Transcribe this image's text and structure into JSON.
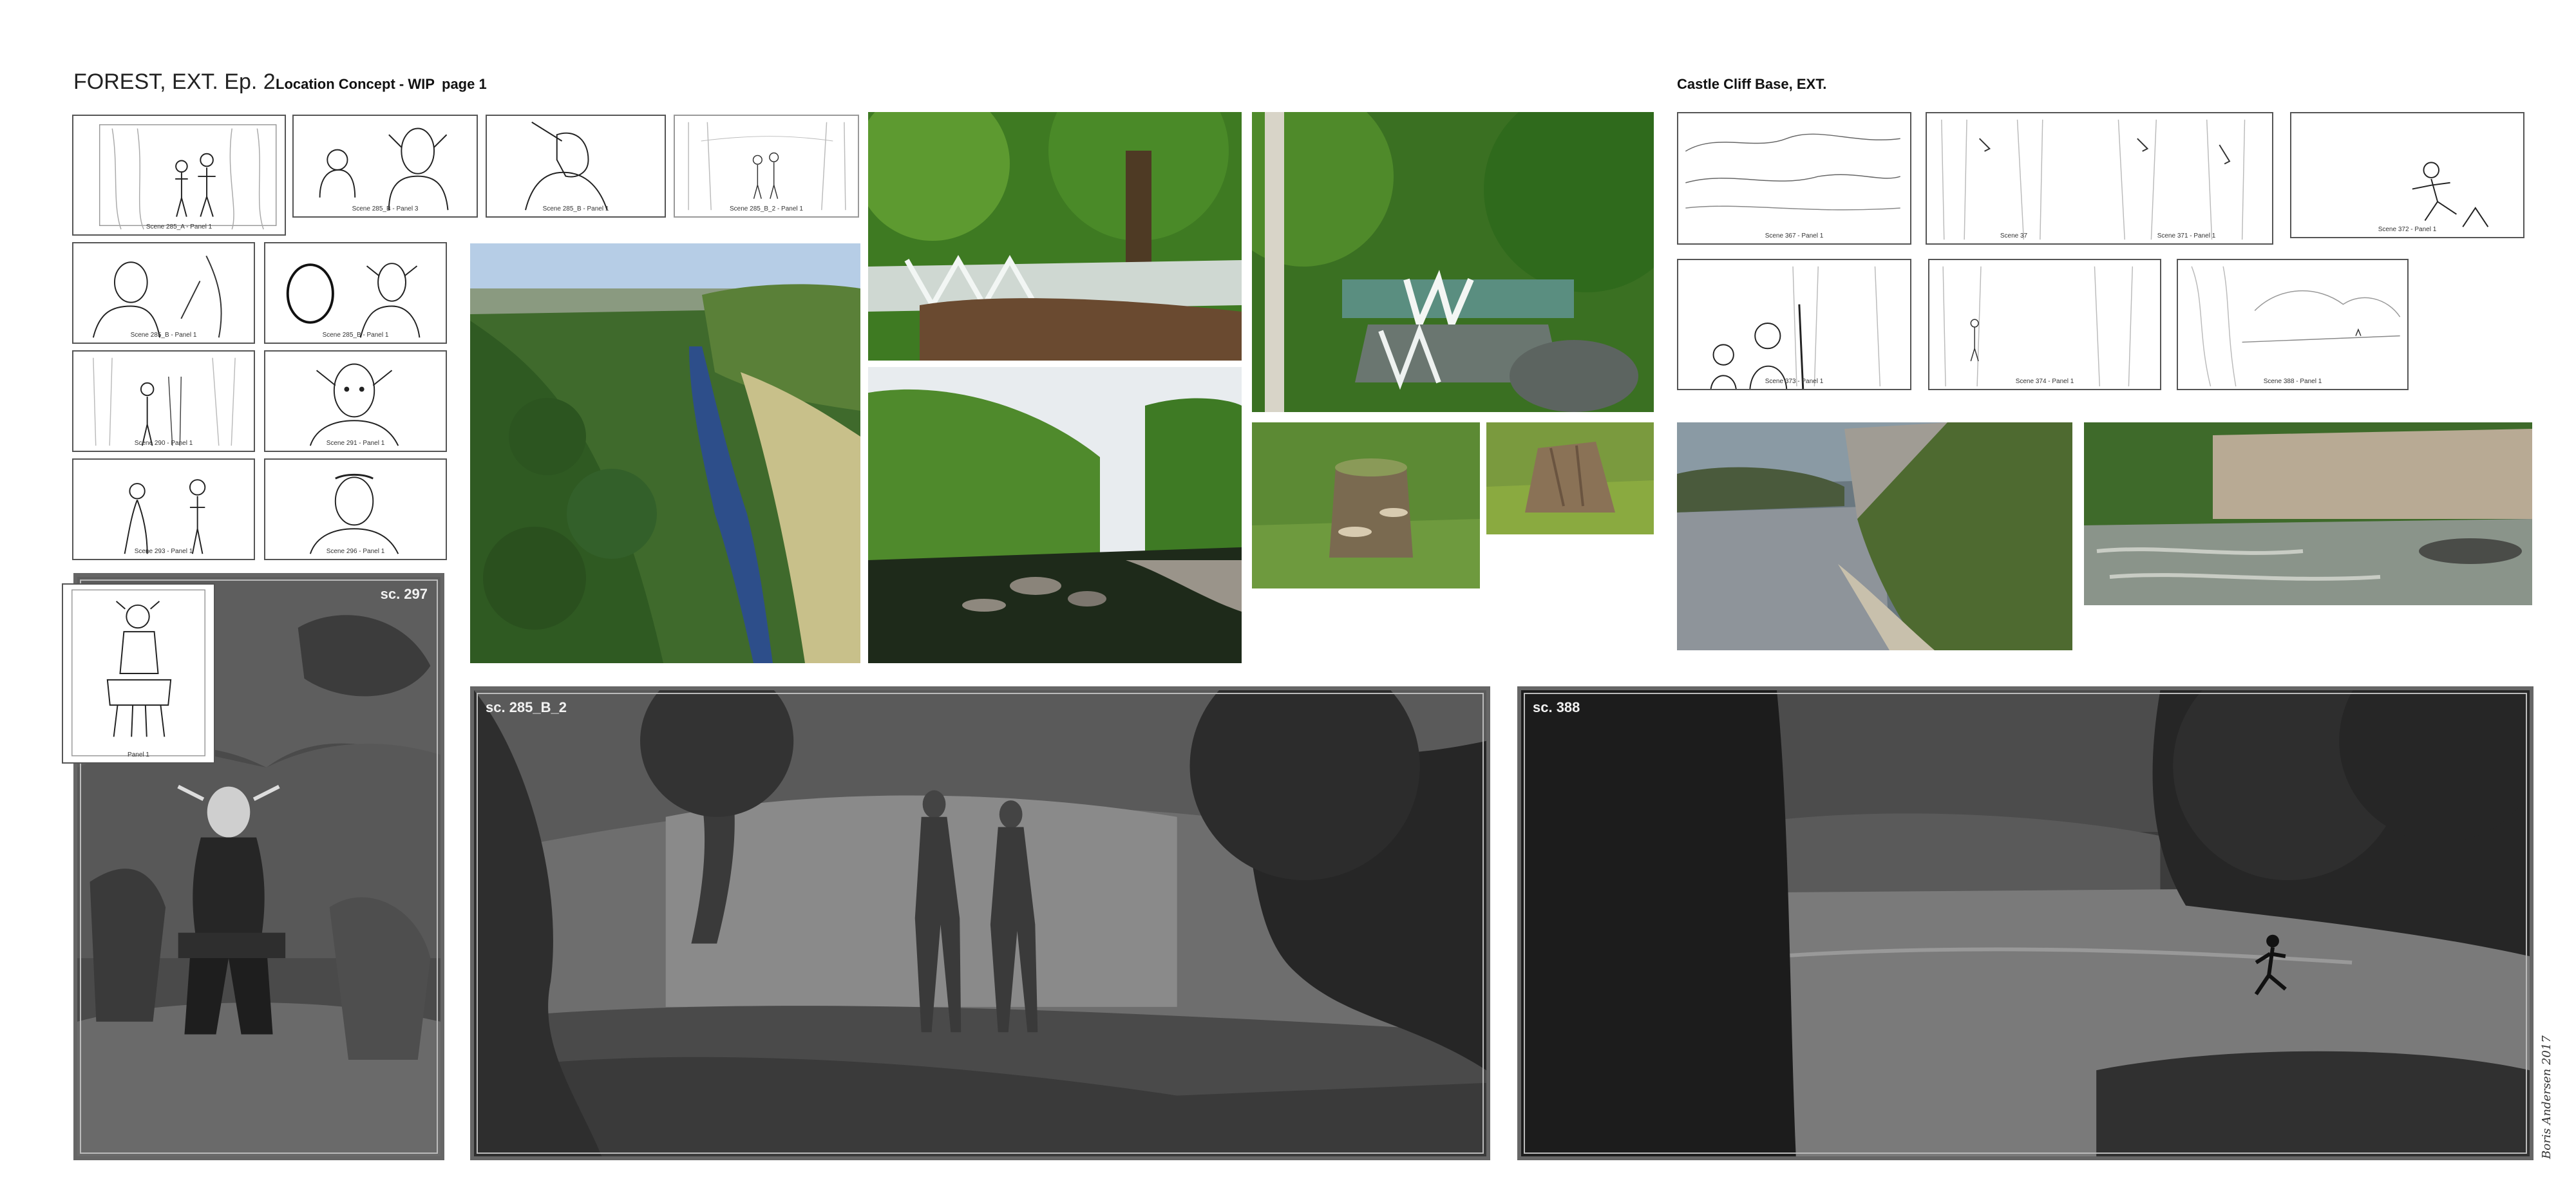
{
  "header": {
    "title": "FOREST, EXT. Ep. 2",
    "subtitle": "Location Concept - WIP",
    "page": "page 1",
    "castle_title": "Castle Cliff Base, EXT."
  },
  "sketches_left": [
    {
      "caption": "Scene 285_A - Panel 1"
    },
    {
      "caption": "Scene 285_B - Panel 3"
    },
    {
      "caption": "Scene 285_B - Panel 1"
    },
    {
      "caption": "Scene 285_B_2 - Panel 1"
    },
    {
      "caption": "Scene 285_B - Panel 1"
    },
    {
      "caption": "Scene 285_B - Panel 1"
    },
    {
      "caption": "Scene 290 - Panel 1"
    },
    {
      "caption": "Scene 291 - Panel 1"
    },
    {
      "caption": "Scene 293 - Panel 1"
    },
    {
      "caption": "Scene 296 - Panel 1"
    },
    {
      "caption": "Panel 1"
    }
  ],
  "sketches_castle": [
    {
      "caption": "Scene 367 - Panel 1"
    },
    {
      "caption": "Scene 37"
    },
    {
      "caption": "Scene 371 - Panel 1"
    },
    {
      "caption": "Scene 372 - Panel 1"
    },
    {
      "caption": "Scene 373 - Panel 1"
    },
    {
      "caption": "Scene 374 - Panel 1"
    },
    {
      "caption": "Scene 388 - Panel 1"
    }
  ],
  "concepts": {
    "sc297": "sc. 297",
    "sc285": "sc. 285_B_2",
    "sc388": "sc. 388"
  },
  "signature": "Boris Andersen 2017"
}
